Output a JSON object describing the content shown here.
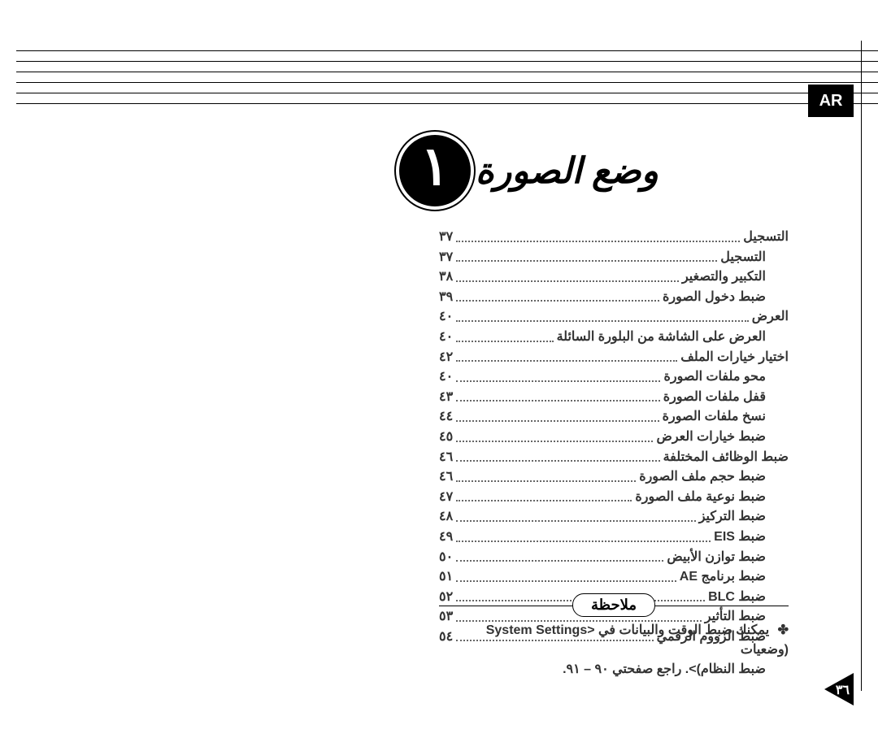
{
  "lang_badge": "AR",
  "chapter": {
    "number": "١",
    "title": "وضع الصورة"
  },
  "toc": [
    {
      "level": 0,
      "title": "التسجيل",
      "page": "٣٧"
    },
    {
      "level": 1,
      "title": "التسجيل",
      "page": "٣٧"
    },
    {
      "level": 1,
      "title": "التكبير والتصغير",
      "page": "٣٨"
    },
    {
      "level": 1,
      "title": "ضبط دخول الصورة",
      "page": "٣٩"
    },
    {
      "level": 0,
      "title": "العرض",
      "page": "٤٠"
    },
    {
      "level": 1,
      "title": "العرض على الشاشة من البلورة السائلة",
      "page": "٤٠"
    },
    {
      "level": 0,
      "title": "اختيار خيارات الملف",
      "page": "٤٢"
    },
    {
      "level": 1,
      "title": "محو ملفات الصورة",
      "page": "٤٠"
    },
    {
      "level": 1,
      "title": "قفل ملفات الصورة",
      "page": "٤٣"
    },
    {
      "level": 1,
      "title": "نسخ ملفات الصورة",
      "page": "٤٤"
    },
    {
      "level": 1,
      "title": "ضبط خيارات العرض",
      "page": "٤٥"
    },
    {
      "level": 0,
      "title": "ضبط الوظائف المختلفة",
      "page": "٤٦"
    },
    {
      "level": 1,
      "title": "ضبط حجم ملف الصورة",
      "page": "٤٦"
    },
    {
      "level": 1,
      "title": "ضبط نوعية ملف الصورة",
      "page": "٤٧"
    },
    {
      "level": 1,
      "title": "ضبط التركيز",
      "page": "٤٨"
    },
    {
      "level": 1,
      "title": "ضبط EIS",
      "page": "٤٩"
    },
    {
      "level": 1,
      "title": "ضبط توازن الأبيض",
      "page": "٥٠"
    },
    {
      "level": 1,
      "title": "ضبط برنامج AE",
      "page": "٥١"
    },
    {
      "level": 1,
      "title": "ضبط BLC",
      "page": "٥٢"
    },
    {
      "level": 1,
      "title": "ضبط التأثير",
      "page": "٥٣"
    },
    {
      "level": 1,
      "title": "ضبط الزووم الرقمي",
      "page": "٥٤"
    }
  ],
  "note": {
    "label": "ملاحظة",
    "bullet": "✤",
    "line1": "يمكنك ضبط الوقت والبيانات في <System Settings (وضعيات",
    "line2": "ضبط النظام)>. راجع صفحتي ٩٠ – ٩١."
  },
  "page_number": "٣٦"
}
